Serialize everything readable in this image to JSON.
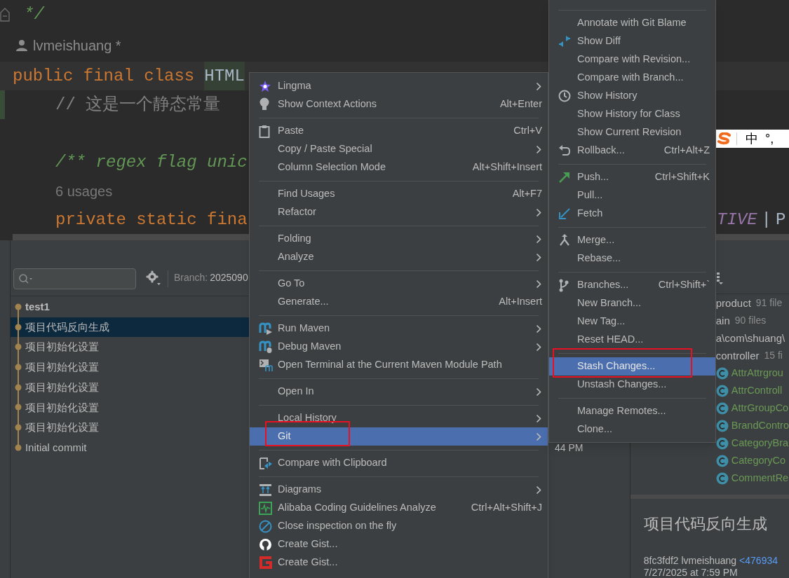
{
  "editor": {
    "lines": [
      {
        "kind": "comment_end",
        "text": "*/",
        "changed": false
      },
      {
        "kind": "author",
        "text": "lvmeishuang *",
        "changed": false
      },
      {
        "kind": "class_decl",
        "keyword": "public final class",
        "name": "HTML",
        "changed": false
      },
      {
        "kind": "line_comment",
        "text": "// 这是一个静态常量",
        "changed": true
      },
      {
        "kind": "blank",
        "changed": false
      },
      {
        "kind": "doc_comment",
        "text": "/** regex flag unic",
        "changed": false
      },
      {
        "kind": "usages",
        "text": "6 usages",
        "changed": false
      },
      {
        "kind": "declaration",
        "text": "private static fina",
        "changed": false
      }
    ],
    "code_tail": [
      {
        "kind": "constant",
        "text": "TIVE"
      },
      {
        "kind": "operator",
        "text": "|"
      },
      {
        "kind": "plain",
        "text": "P"
      }
    ],
    "ime_bar": {
      "mode": "中",
      "punctuation": "°,"
    }
  },
  "git_log": {
    "branch": {
      "label": "Branch:",
      "value": "2025090"
    },
    "commits": [
      {
        "message": "test1",
        "current": true,
        "selected": false
      },
      {
        "message": "项目代码反向生成",
        "current": false,
        "selected": true
      },
      {
        "message": "项目初始化设置",
        "current": false,
        "selected": false
      },
      {
        "message": "项目初始化设置",
        "current": false,
        "selected": false
      },
      {
        "message": "项目初始化设置",
        "current": false,
        "selected": false
      },
      {
        "message": "项目初始化设置",
        "current": false,
        "selected": false
      },
      {
        "message": "项目初始化设置",
        "current": false,
        "selected": false
      },
      {
        "message": "Initial commit",
        "current": false,
        "selected": false,
        "date": "44 PM"
      }
    ]
  },
  "changes_tree": [
    {
      "kind": "folder",
      "label": "product",
      "count": "91 file",
      "children": [
        {
          "kind": "folder",
          "label": "ain",
          "count": "90 files",
          "children": [
            {
              "kind": "folder",
              "label": "a\\com\\shuang\\",
              "children": [
                {
                  "kind": "folder",
                  "label": "controller",
                  "count": "15 fi",
                  "children": [
                    {
                      "kind": "class",
                      "label": "AttrAttrgrou"
                    },
                    {
                      "kind": "class",
                      "label": "AttrControll"
                    },
                    {
                      "kind": "class",
                      "label": "AttrGroupCo"
                    },
                    {
                      "kind": "class",
                      "label": "BrandContro"
                    },
                    {
                      "kind": "class",
                      "label": "CategoryBra"
                    },
                    {
                      "kind": "class",
                      "label": "CategoryCo"
                    },
                    {
                      "kind": "class",
                      "label": "CommentRe"
                    }
                  ]
                }
              ]
            }
          ]
        }
      ]
    }
  ],
  "commit_details": {
    "title": "项目代码反向生成",
    "hash_author": "8fc3fdf2 lvmeishuang",
    "email": "<476934",
    "date": "7/27/2025 at 7:59 PM"
  },
  "context_menu": {
    "items": [
      {
        "kind": "item",
        "label": "Lingma",
        "has_submenu": true,
        "selected": false
      },
      {
        "kind": "item",
        "label": "Show Context Actions",
        "shortcut": "Alt+Enter",
        "has_submenu": false,
        "selected": false
      },
      {
        "kind": "separator"
      },
      {
        "kind": "item",
        "label": "Paste",
        "shortcut": "Ctrl+V",
        "has_submenu": false,
        "selected": false
      },
      {
        "kind": "item",
        "label": "Copy / Paste Special",
        "has_submenu": true,
        "selected": false
      },
      {
        "kind": "item",
        "label": "Column Selection Mode",
        "shortcut": "Alt+Shift+Insert",
        "has_submenu": false,
        "selected": false
      },
      {
        "kind": "separator"
      },
      {
        "kind": "item",
        "label": "Find Usages",
        "shortcut": "Alt+F7",
        "has_submenu": false,
        "selected": false
      },
      {
        "kind": "item",
        "label": "Refactor",
        "has_submenu": true,
        "selected": false
      },
      {
        "kind": "separator"
      },
      {
        "kind": "item",
        "label": "Folding",
        "has_submenu": true,
        "selected": false
      },
      {
        "kind": "item",
        "label": "Analyze",
        "has_submenu": true,
        "selected": false
      },
      {
        "kind": "separator"
      },
      {
        "kind": "item",
        "label": "Go To",
        "has_submenu": true,
        "selected": false
      },
      {
        "kind": "item",
        "label": "Generate...",
        "shortcut": "Alt+Insert",
        "has_submenu": false,
        "selected": false
      },
      {
        "kind": "separator"
      },
      {
        "kind": "item",
        "label": "Run Maven",
        "has_submenu": true,
        "selected": false
      },
      {
        "kind": "item",
        "label": "Debug Maven",
        "has_submenu": true,
        "selected": false
      },
      {
        "kind": "item",
        "label": "Open Terminal at the Current Maven Module Path",
        "has_submenu": false,
        "selected": false
      },
      {
        "kind": "separator"
      },
      {
        "kind": "item",
        "label": "Open In",
        "has_submenu": true,
        "selected": false
      },
      {
        "kind": "separator"
      },
      {
        "kind": "item",
        "label": "Local History",
        "has_submenu": true,
        "selected": false
      },
      {
        "kind": "item",
        "label": "Git",
        "has_submenu": true,
        "selected": true
      },
      {
        "kind": "separator"
      },
      {
        "kind": "item",
        "label": "Compare with Clipboard",
        "has_submenu": false,
        "selected": false
      },
      {
        "kind": "separator"
      },
      {
        "kind": "item",
        "label": "Diagrams",
        "has_submenu": true,
        "selected": false
      },
      {
        "kind": "item",
        "label": "Alibaba Coding Guidelines Analyze",
        "shortcut": "Ctrl+Alt+Shift+J",
        "has_submenu": false,
        "selected": false
      },
      {
        "kind": "item",
        "label": "Close inspection on the fly",
        "has_submenu": false,
        "selected": false
      },
      {
        "kind": "item",
        "label": "Create Gist...",
        "has_submenu": false,
        "selected": false
      },
      {
        "kind": "item",
        "label": "Create Gist...",
        "has_submenu": false,
        "selected": false
      }
    ]
  },
  "git_submenu": {
    "items": [
      {
        "kind": "separator"
      },
      {
        "kind": "item",
        "label": "Annotate with Git Blame",
        "selected": false
      },
      {
        "kind": "item",
        "label": "Show Diff",
        "selected": false
      },
      {
        "kind": "item",
        "label": "Compare with Revision...",
        "selected": false
      },
      {
        "kind": "item",
        "label": "Compare with Branch...",
        "selected": false
      },
      {
        "kind": "item",
        "label": "Show History",
        "selected": false
      },
      {
        "kind": "item",
        "label": "Show History for Class",
        "selected": false
      },
      {
        "kind": "item",
        "label": "Show Current Revision",
        "selected": false
      },
      {
        "kind": "item",
        "label": "Rollback...",
        "shortcut": "Ctrl+Alt+Z",
        "selected": false
      },
      {
        "kind": "separator"
      },
      {
        "kind": "item",
        "label": "Push...",
        "shortcut": "Ctrl+Shift+K",
        "selected": false
      },
      {
        "kind": "item",
        "label": "Pull...",
        "selected": false
      },
      {
        "kind": "item",
        "label": "Fetch",
        "selected": false
      },
      {
        "kind": "separator"
      },
      {
        "kind": "item",
        "label": "Merge...",
        "selected": false
      },
      {
        "kind": "item",
        "label": "Rebase...",
        "selected": false
      },
      {
        "kind": "separator"
      },
      {
        "kind": "item",
        "label": "Branches...",
        "shortcut": "Ctrl+Shift+`",
        "selected": false
      },
      {
        "kind": "item",
        "label": "New Branch...",
        "selected": false
      },
      {
        "kind": "item",
        "label": "New Tag...",
        "selected": false
      },
      {
        "kind": "item",
        "label": "Reset HEAD...",
        "selected": false
      },
      {
        "kind": "separator"
      },
      {
        "kind": "item",
        "label": "Stash Changes...",
        "selected": true
      },
      {
        "kind": "item",
        "label": "Unstash Changes...",
        "selected": false
      },
      {
        "kind": "separator"
      },
      {
        "kind": "item",
        "label": "Manage Remotes...",
        "selected": false
      },
      {
        "kind": "item",
        "label": "Clone...",
        "selected": false
      }
    ]
  }
}
